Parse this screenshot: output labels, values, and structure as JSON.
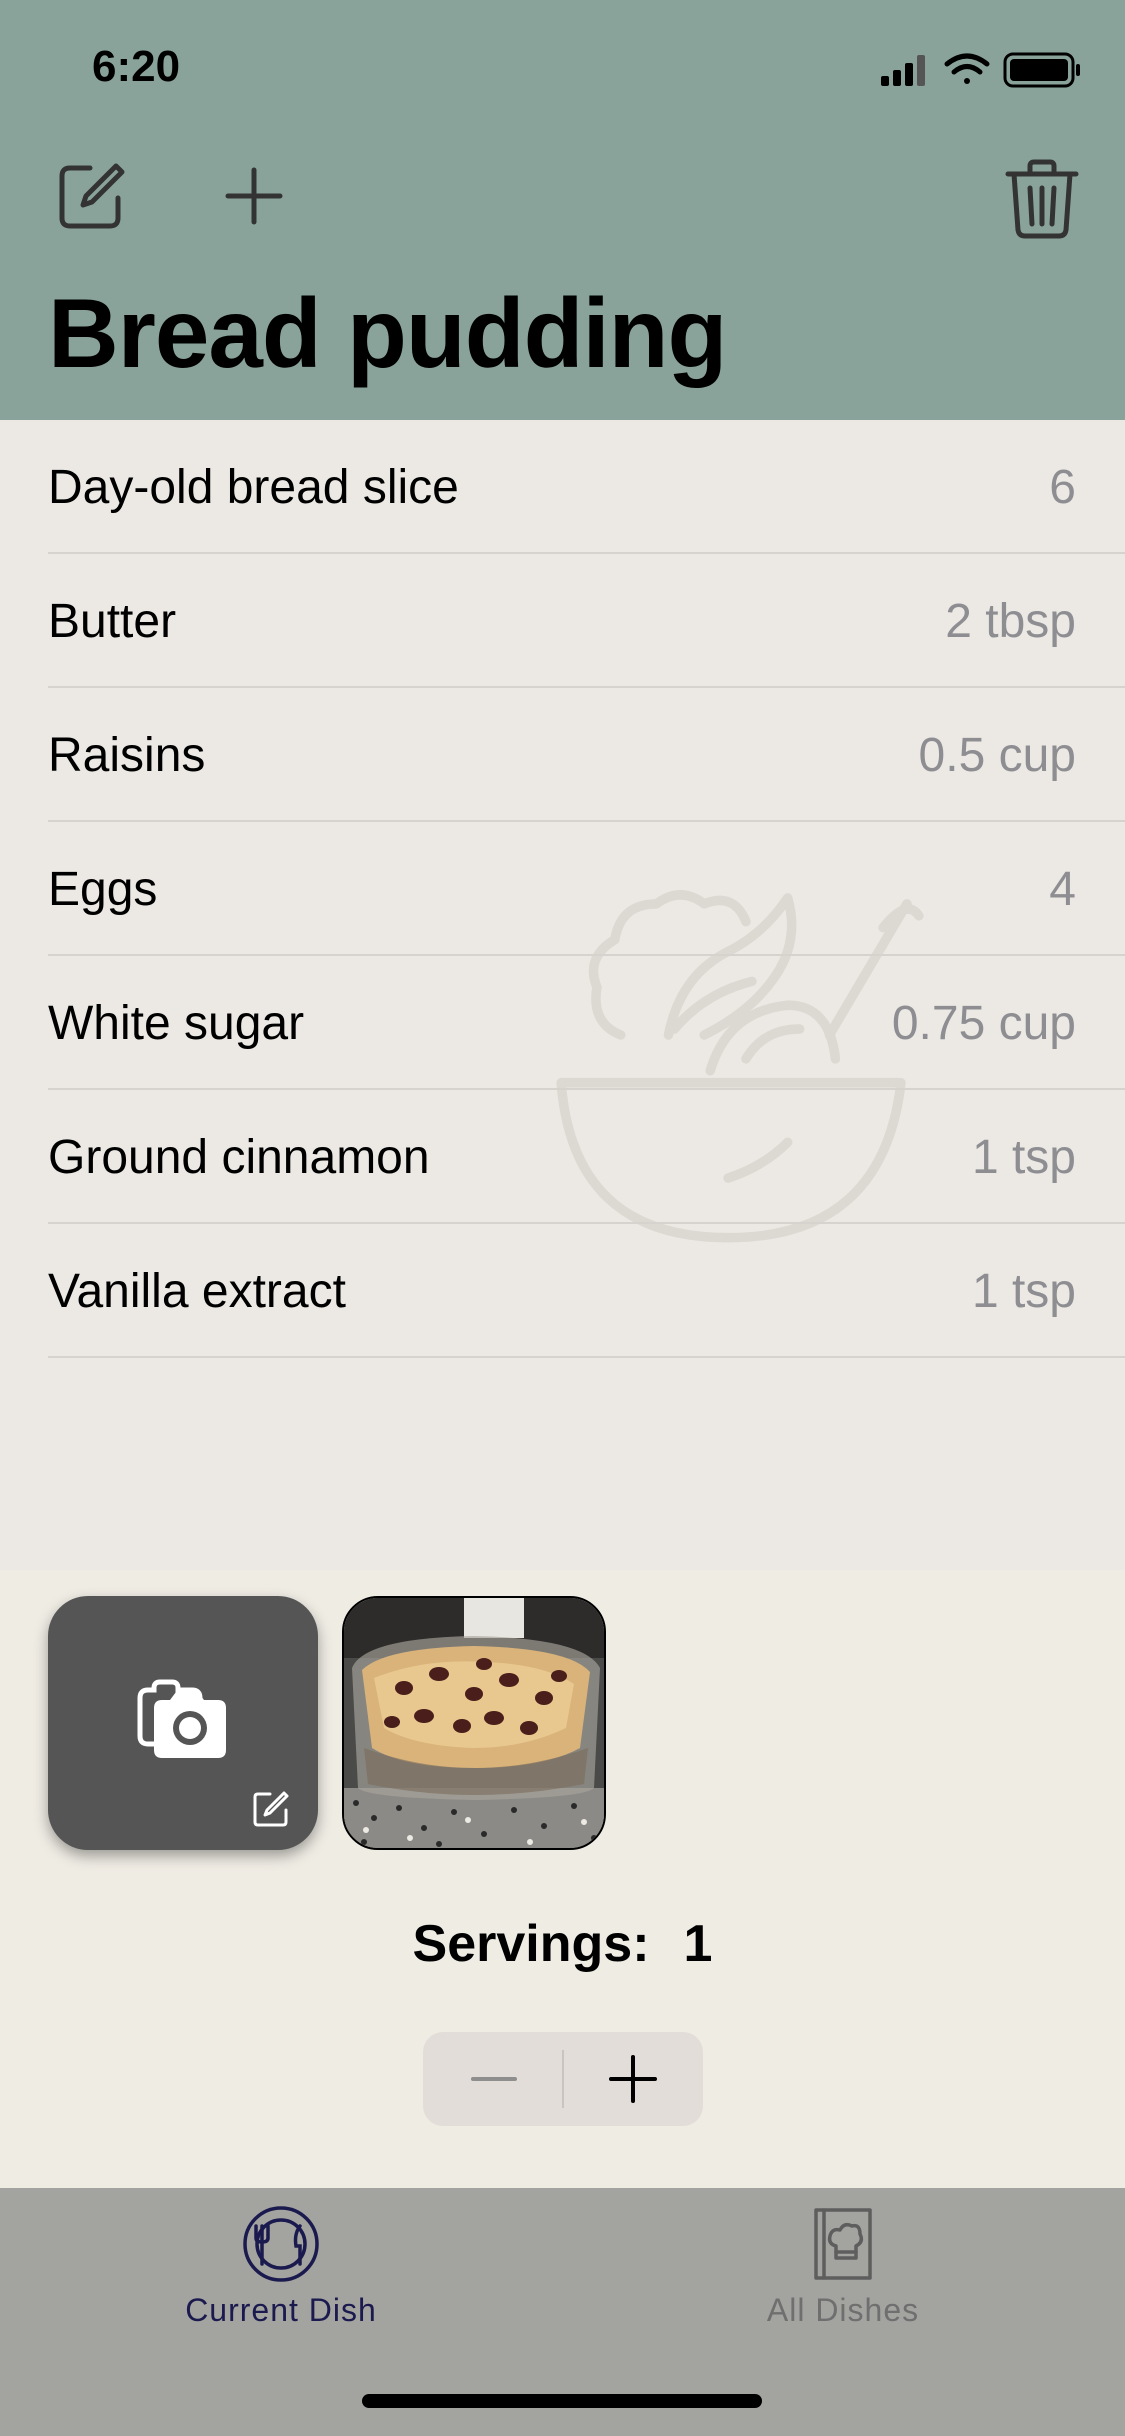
{
  "status_bar": {
    "time": "6:20"
  },
  "header": {
    "title": "Bread pudding"
  },
  "ingredients": [
    {
      "name": "Day-old bread slice",
      "quantity": "6"
    },
    {
      "name": "Butter",
      "quantity": "2 tbsp"
    },
    {
      "name": "Raisins",
      "quantity": "0.5 cup"
    },
    {
      "name": "Eggs",
      "quantity": "4"
    },
    {
      "name": "White sugar",
      "quantity": "0.75 cup"
    },
    {
      "name": "Ground cinnamon",
      "quantity": "1 tsp"
    },
    {
      "name": "Vanilla extract",
      "quantity": "1 tsp"
    }
  ],
  "servings": {
    "label": "Servings:",
    "value": "1"
  },
  "tabs": [
    {
      "label": "Current Dish",
      "icon": "plate-utensils-icon",
      "selected": true
    },
    {
      "label": "All Dishes",
      "icon": "cookbook-icon",
      "selected": false
    }
  ],
  "colors": {
    "header_bg": "#89A39B",
    "list_bg": "#ECE9E4",
    "tab_bar_bg": "#A3A3A0",
    "selected_tab": "#1B1A4E",
    "quantity_text": "#8E8E92"
  }
}
